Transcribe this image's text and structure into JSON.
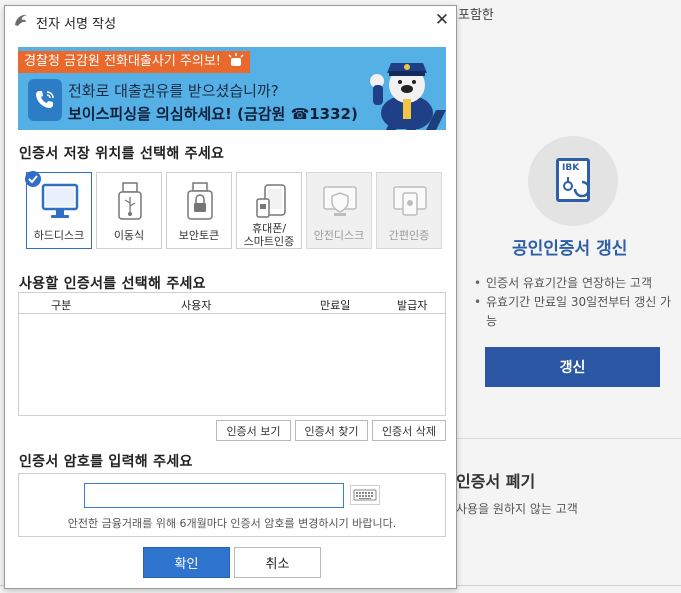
{
  "background": {
    "top_text": "포함한",
    "renew": {
      "icon_text": "IBK",
      "title": "공인인증서 갱신",
      "bullets": [
        "인증서 유효기간을 연장하는 고객",
        "유효기간 만료일 30일전부터 갱신 가능"
      ],
      "button": "갱신"
    },
    "revoke": {
      "title": "인증서 폐기",
      "desc": "사용을 원하지 않는 고객"
    }
  },
  "dialog": {
    "title": "전자 서명 작성",
    "banner": {
      "tag": "경찰청 금감원 전화대출사기 주의보!",
      "line1": "전화로 대출권유를 받으셨습니까?",
      "line2": "보이스피싱을 의심하세요! (금감원 ☎1332)"
    },
    "storage": {
      "title": "인증서 저장 위치를 선택해 주세요",
      "items": [
        {
          "label": "하드디스크",
          "icon": "monitor-icon",
          "selected": true,
          "disabled": false
        },
        {
          "label": "이동식",
          "icon": "usb-icon",
          "selected": false,
          "disabled": false
        },
        {
          "label": "보안토큰",
          "icon": "security-token-icon",
          "selected": false,
          "disabled": false
        },
        {
          "label": "휴대폰/스마트인증",
          "label_l1": "휴대폰/",
          "label_l2": "스마트인증",
          "icon": "phone-icon",
          "selected": false,
          "disabled": false
        },
        {
          "label": "안전디스크",
          "icon": "safe-disk-icon",
          "selected": false,
          "disabled": true
        },
        {
          "label": "간편인증",
          "icon": "simple-auth-icon",
          "selected": false,
          "disabled": true
        }
      ]
    },
    "certificate": {
      "title": "사용할 인증서를 선택해 주세요",
      "columns": [
        "구분",
        "사용자",
        "만료일",
        "발급자"
      ],
      "rows": [],
      "buttons": {
        "view": "인증서 보기",
        "find": "인증서 찾기",
        "delete": "인증서 삭제"
      }
    },
    "password": {
      "title": "인증서 암호를 입력해 주세요",
      "value": "",
      "note": "안전한 금융거래를 위해 6개월마다 인증서 암호를 변경하시기 바랍니다."
    },
    "buttons": {
      "ok": "확인",
      "cancel": "취소"
    }
  },
  "colors": {
    "accent": "#2f75cf",
    "banner_bg": "#55b1e5",
    "banner_tag": "#e9682c",
    "bg_button": "#2a56a4"
  }
}
